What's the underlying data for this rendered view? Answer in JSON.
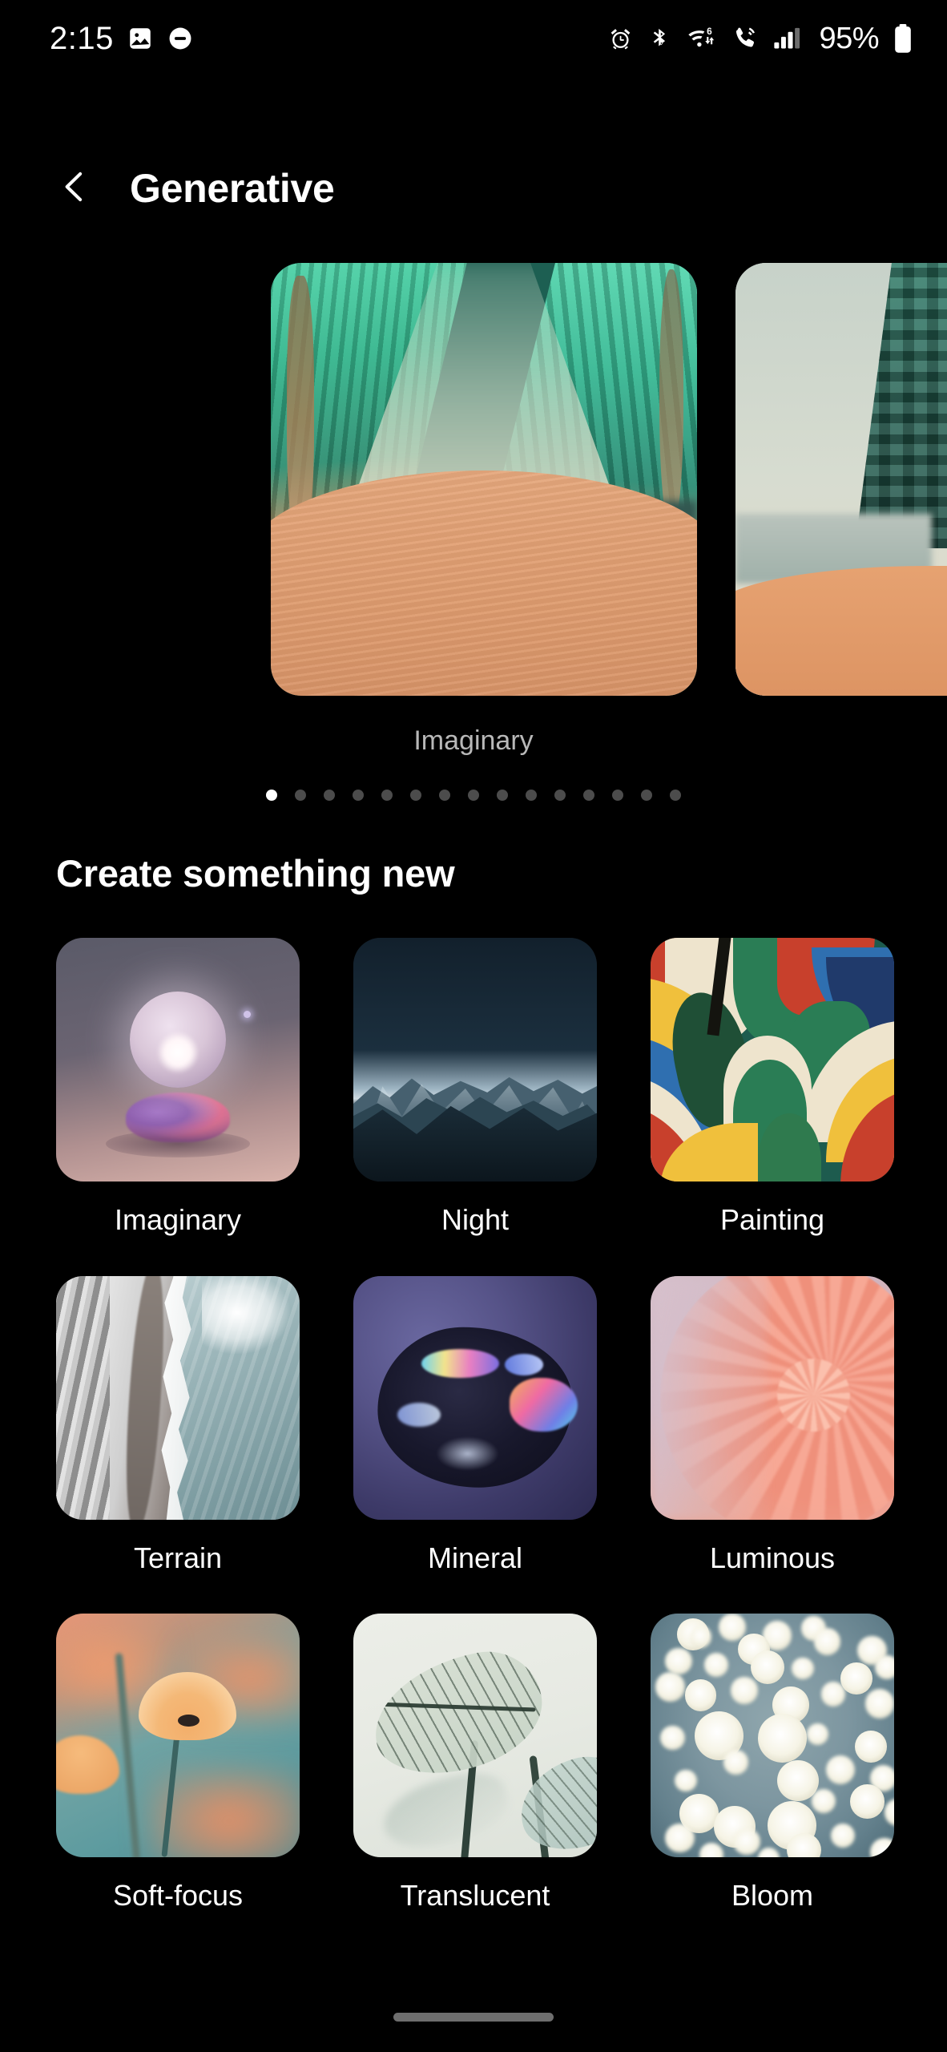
{
  "status_bar": {
    "time": "2:15",
    "left_icons": [
      "image-icon",
      "do-not-disturb-icon"
    ],
    "right_icons": [
      "alarm-icon",
      "bluetooth-icon",
      "wifi-6-icon",
      "volte-call-icon",
      "cellular-signal-icon"
    ],
    "wifi_generation": "6",
    "battery_percent": "95%"
  },
  "app_bar": {
    "back_icon": "chevron-left-icon",
    "title": "Generative"
  },
  "carousel": {
    "label": "Imaginary",
    "active_index": 0,
    "total_pages": 15,
    "cards": [
      {
        "name": "Imaginary",
        "art": "teal-canyon-orange-dune"
      },
      {
        "name": "Imaginary",
        "art": "blocky-green-cliff-orange-sand"
      }
    ]
  },
  "section": {
    "heading": "Create something new"
  },
  "grid": {
    "items": [
      {
        "label": "Imaginary",
        "art": "glowing-orb-over-flowers"
      },
      {
        "label": "Night",
        "art": "dark-blue-mountain-range"
      },
      {
        "label": "Painting",
        "art": "abstract-tropical-leaves"
      },
      {
        "label": "Terrain",
        "art": "aerial-shoreline-sand-surf"
      },
      {
        "label": "Mineral",
        "art": "iridescent-dark-crystal"
      },
      {
        "label": "Luminous",
        "art": "pink-dahlia-closeup"
      },
      {
        "label": "Soft-focus",
        "art": "orange-poppies-teal-bokeh"
      },
      {
        "label": "Translucent",
        "art": "backlit-veined-leaf"
      },
      {
        "label": "Bloom",
        "art": "white-flowers-on-water"
      }
    ]
  },
  "nav_bar": {
    "gesture_pill": "home-gesture-pill"
  },
  "colors": {
    "background": "#000000",
    "text_primary": "#ffffff",
    "text_secondary": "#b8b8b8",
    "dot_inactive": "#4c4c4c",
    "dot_active": "#ffffff",
    "nav_pill": "#6e6e6e"
  }
}
